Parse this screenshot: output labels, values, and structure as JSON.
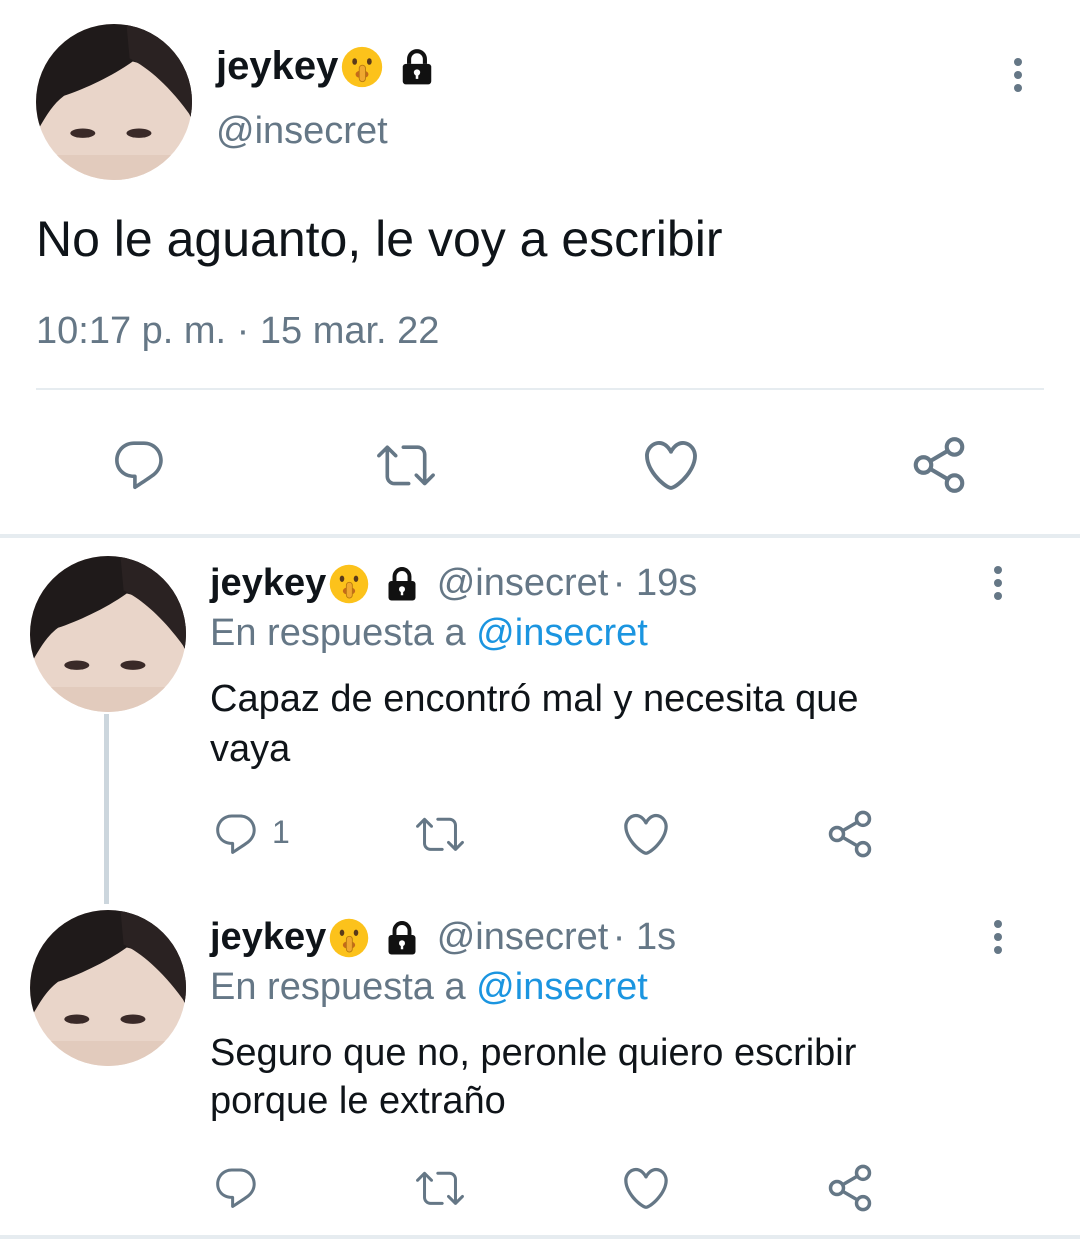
{
  "main_tweet": {
    "display_name": "jeykey",
    "handle": "@insecret",
    "text": "No le aguanto, le voy a escribir",
    "timestamp": "10:17 p. m. · 15 mar. 22"
  },
  "replies": [
    {
      "display_name": "jeykey",
      "handle": "@insecret",
      "time": "· 19s",
      "reply_prefix": "En respuesta a",
      "reply_to": "@insecret",
      "text_line1": "Capaz de encontró mal y necesita que",
      "text_line2": "vaya",
      "reply_count": "1"
    },
    {
      "display_name": "jeykey",
      "handle": "@insecret",
      "time": "· 1s",
      "reply_prefix": "En respuesta a",
      "reply_to": "@insecret",
      "text_line1": "Seguro que no, peronle quiero escribir",
      "text_line2": "porque le extraño",
      "reply_count": ""
    }
  ],
  "icons": [
    "shushing-face-emoji",
    "lock-icon",
    "more-icon",
    "reply-icon",
    "retweet-icon",
    "like-icon",
    "share-icon"
  ],
  "colors": {
    "muted": "#657786",
    "link": "#1b95e0",
    "text": "#0f1419",
    "divider": "#e6ecf0"
  }
}
